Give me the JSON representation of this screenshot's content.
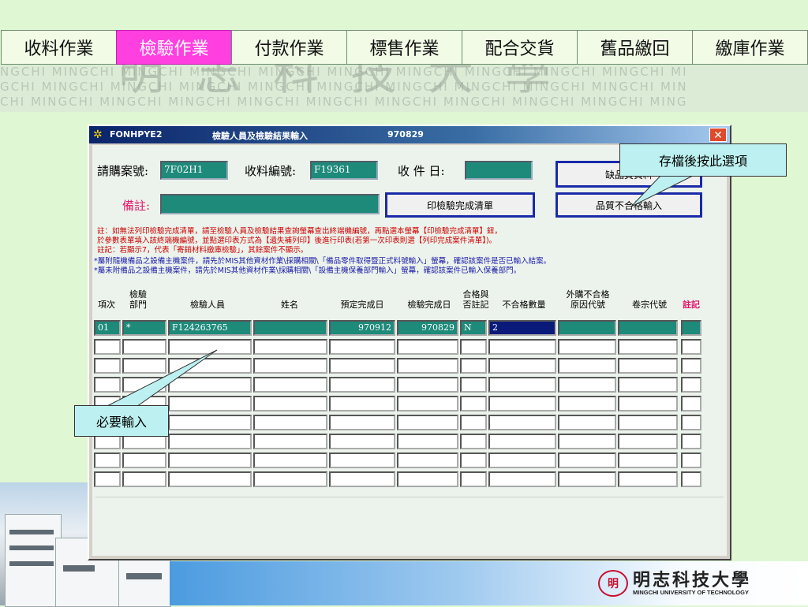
{
  "nav": {
    "tabs": [
      "收料作業",
      "檢驗作業",
      "付款作業",
      "標售作業",
      "配合交貨",
      "舊品繳回",
      "繳庫作業"
    ],
    "active_index": 1,
    "active_color": "#ff3fe0"
  },
  "watermark": {
    "lines": [
      "NGCHI MINGCHI MINGCHI MINGCHI MINGCHI MINGCHI MINGCHI MINGCHI MINGCHI MINGCHI MI",
      "GCHI MINGCHI MINGCHI MINGCHI MINGCHI MINGCHI MINGCHI MINGCHI MINGCHI MINGCHI MIN",
      "CHI MINGCHI MINGCHI MINGCHI MINGCHI MINGCHI MINGCHI MINGCHI MINGCHI MINGCHI MING"
    ],
    "big_text": "明志科技大學"
  },
  "window": {
    "form_id": "FONHPYE2",
    "title": "檢驗人員及檢驗結果輸入",
    "date": "970829",
    "close_icon": "close-icon"
  },
  "form": {
    "purchase_no_label": "請購案號:",
    "purchase_no_value": "7F02H1",
    "receipt_no_label": "收料編號:",
    "receipt_no_value": "F19361",
    "receive_date_label": "收 件 日:",
    "receive_date_value": "",
    "remark_label": "備註:",
    "remark_value": "",
    "btn_shortage": "缺品質資料",
    "btn_print": "印檢驗完成清單",
    "btn_fail_input": "品質不合格輸入"
  },
  "notes": {
    "red": [
      "註：如無法列印檢驗完成清單，請至檢驗人員及檢驗結果查詢螢幕查出終端機編號，再點選本螢幕【印檢驗完成清單】鈕，",
      "於參數表單填入該終端機編號，並點選印表方式為【遺失補列印】後進行印表(若第一次印表則選【列印完成案件清單】)。",
      "註記：若顯示7，代表「寄銷材料繳庫檢驗」，其餘案件不顯示。"
    ],
    "blue": [
      "*屬附隨機備品之設備主機案件，請先於MIS其他資材作業\\採購相關\\「備品零件取得暨正式料號輸入」螢幕，確認該案件是否已輸入結案。",
      "*屬未附備品之設備主機案件，請先於MIS其他資材作業\\採購相關\\「設備主機保養部門輸入」螢幕，確認該案件已輸入保養部門。"
    ]
  },
  "table": {
    "headers": {
      "item": "項次",
      "dept": "檢驗\n部門",
      "inspector": "檢驗人員",
      "name": "姓名",
      "due": "預定完成日",
      "done": "檢驗完成日",
      "pass": "合格與\n否註記",
      "fail_qty": "不合格數量",
      "reason": "外購不合格\n原因代號",
      "file": "卷宗代號",
      "mark": "註記"
    },
    "rows": [
      {
        "item": "01",
        "dept": "*",
        "inspector": "F124263765",
        "name": "",
        "due": "970912",
        "done": "970829",
        "pass": "N",
        "fail_qty": "2",
        "reason": "",
        "file": "",
        "mark": ""
      },
      {
        "item": "",
        "dept": "",
        "inspector": "",
        "name": "",
        "due": "",
        "done": "",
        "pass": "",
        "fail_qty": "",
        "reason": "",
        "file": "",
        "mark": ""
      },
      {
        "item": "",
        "dept": "",
        "inspector": "",
        "name": "",
        "due": "",
        "done": "",
        "pass": "",
        "fail_qty": "",
        "reason": "",
        "file": "",
        "mark": ""
      },
      {
        "item": "",
        "dept": "",
        "inspector": "",
        "name": "",
        "due": "",
        "done": "",
        "pass": "",
        "fail_qty": "",
        "reason": "",
        "file": "",
        "mark": ""
      },
      {
        "item": "",
        "dept": "",
        "inspector": "",
        "name": "",
        "due": "",
        "done": "",
        "pass": "",
        "fail_qty": "",
        "reason": "",
        "file": "",
        "mark": ""
      },
      {
        "item": "",
        "dept": "",
        "inspector": "",
        "name": "",
        "due": "",
        "done": "",
        "pass": "",
        "fail_qty": "",
        "reason": "",
        "file": "",
        "mark": ""
      },
      {
        "item": "",
        "dept": "",
        "inspector": "",
        "name": "",
        "due": "",
        "done": "",
        "pass": "",
        "fail_qty": "",
        "reason": "",
        "file": "",
        "mark": ""
      },
      {
        "item": "",
        "dept": "",
        "inspector": "",
        "name": "",
        "due": "",
        "done": "",
        "pass": "",
        "fail_qty": "",
        "reason": "",
        "file": "",
        "mark": ""
      },
      {
        "item": "",
        "dept": "",
        "inspector": "",
        "name": "",
        "due": "",
        "done": "",
        "pass": "",
        "fail_qty": "",
        "reason": "",
        "file": "",
        "mark": ""
      }
    ]
  },
  "callouts": {
    "save_hint": "存檔後按此選項",
    "required_hint": "必要輸入"
  },
  "logo": {
    "mark": "明",
    "name_zh": "明志科技大學",
    "name_en": "MINGCHI UNIVERSITY OF TECHNOLOGY"
  }
}
